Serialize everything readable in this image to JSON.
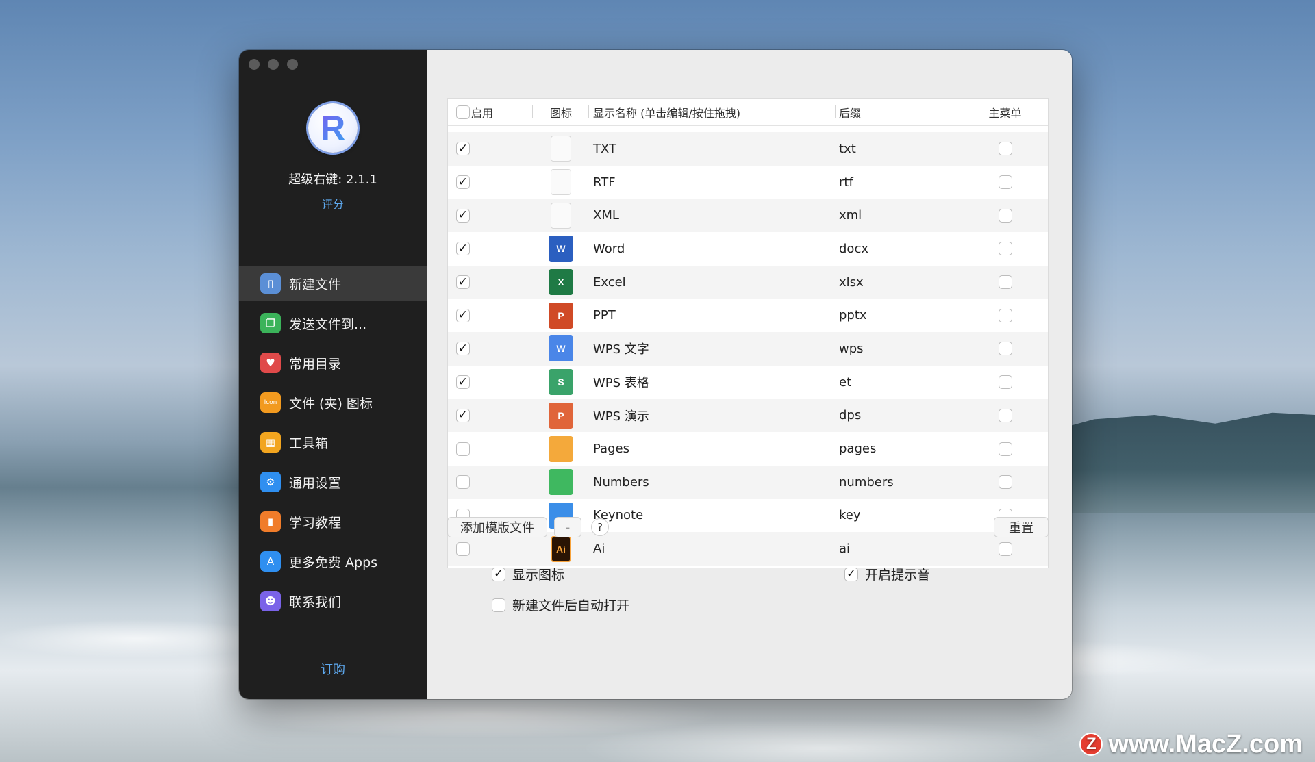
{
  "app": {
    "name": "超级右键: 2.1.1",
    "rate_link": "评分",
    "subscribe_link": "订购",
    "logo_letter": "R"
  },
  "sidebar": {
    "items": [
      {
        "label": "新建文件",
        "icon": "document-icon",
        "color": "#5b8fd6",
        "glyph": "▯",
        "active": true
      },
      {
        "label": "发送文件到...",
        "icon": "copy-icon",
        "color": "#3bb35a",
        "glyph": "❐",
        "active": false
      },
      {
        "label": "常用目录",
        "icon": "heart-icon",
        "color": "#e04a4a",
        "glyph": "♥",
        "active": false
      },
      {
        "label": "文件 (夹) 图标",
        "icon": "icon-badge-icon",
        "color": "#f29a1f",
        "glyph": "Icon",
        "active": false
      },
      {
        "label": "工具箱",
        "icon": "toolbox-icon",
        "color": "#f2a51f",
        "glyph": "▦",
        "active": false
      },
      {
        "label": "通用设置",
        "icon": "gear-icon",
        "color": "#2f8ff0",
        "glyph": "⚙",
        "active": false
      },
      {
        "label": "学习教程",
        "icon": "book-icon",
        "color": "#f07c2a",
        "glyph": "▮",
        "active": false
      },
      {
        "label": "更多免费 Apps",
        "icon": "app-store-icon",
        "color": "#2f8ff0",
        "glyph": "A",
        "active": false
      },
      {
        "label": "联系我们",
        "icon": "contacts-icon",
        "color": "#7a63e8",
        "glyph": "☻",
        "active": false
      }
    ]
  },
  "table": {
    "headers": {
      "enable": "启用",
      "icon": "图标",
      "name": "显示名称 (单击编辑/按住拖拽)",
      "suffix": "后缀",
      "main_menu": "主菜单"
    },
    "rows": [
      {
        "name": "TXT",
        "suffix": "txt",
        "enabled": true,
        "main_menu": false,
        "icon": "txt-file-icon",
        "badge": "",
        "color": "#fafafa"
      },
      {
        "name": "RTF",
        "suffix": "rtf",
        "enabled": true,
        "main_menu": false,
        "icon": "rtf-file-icon",
        "badge": "",
        "color": "#fafafa"
      },
      {
        "name": "XML",
        "suffix": "xml",
        "enabled": true,
        "main_menu": false,
        "icon": "xml-file-icon",
        "badge": "",
        "color": "#fafafa"
      },
      {
        "name": "Word",
        "suffix": "docx",
        "enabled": true,
        "main_menu": false,
        "icon": "word-icon",
        "badge": "W",
        "color": "#2b5fc0"
      },
      {
        "name": "Excel",
        "suffix": "xlsx",
        "enabled": true,
        "main_menu": false,
        "icon": "excel-icon",
        "badge": "X",
        "color": "#1f7a45"
      },
      {
        "name": "PPT",
        "suffix": "pptx",
        "enabled": true,
        "main_menu": false,
        "icon": "powerpoint-icon",
        "badge": "P",
        "color": "#d04a26"
      },
      {
        "name": "WPS 文字",
        "suffix": "wps",
        "enabled": true,
        "main_menu": false,
        "icon": "wps-writer-icon",
        "badge": "W",
        "color": "#4a86e8"
      },
      {
        "name": "WPS 表格",
        "suffix": "et",
        "enabled": true,
        "main_menu": false,
        "icon": "wps-spreadsheet-icon",
        "badge": "S",
        "color": "#3aa36a"
      },
      {
        "name": "WPS 演示",
        "suffix": "dps",
        "enabled": true,
        "main_menu": false,
        "icon": "wps-presentation-icon",
        "badge": "P",
        "color": "#e0653a"
      },
      {
        "name": "Pages",
        "suffix": "pages",
        "enabled": false,
        "main_menu": false,
        "icon": "pages-icon",
        "badge": "",
        "color": "#f4a93b"
      },
      {
        "name": "Numbers",
        "suffix": "numbers",
        "enabled": false,
        "main_menu": false,
        "icon": "numbers-icon",
        "badge": "",
        "color": "#3fb860"
      },
      {
        "name": "Keynote",
        "suffix": "key",
        "enabled": false,
        "main_menu": false,
        "icon": "keynote-icon",
        "badge": "",
        "color": "#3b8ee8"
      },
      {
        "name": "Ai",
        "suffix": "ai",
        "enabled": false,
        "main_menu": false,
        "icon": "illustrator-icon",
        "badge": "Ai",
        "color": "#2a1404"
      }
    ]
  },
  "actions": {
    "add_template": "添加模版文件",
    "remove": "-",
    "help": "?",
    "reset": "重置"
  },
  "options": {
    "show_icon": {
      "label": "显示图标",
      "checked": true
    },
    "sound": {
      "label": "开启提示音",
      "checked": true
    },
    "auto_open": {
      "label": "新建文件后自动打开",
      "checked": false
    }
  },
  "watermark": {
    "text": "www.MacZ.com",
    "logo": "Z"
  }
}
